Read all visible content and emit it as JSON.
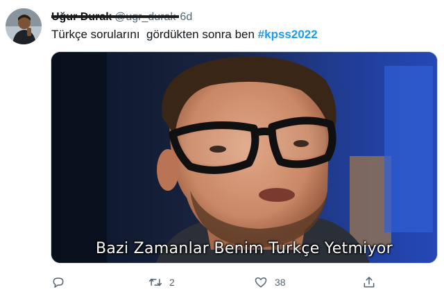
{
  "tweet": {
    "author_name": "Uğur Durak",
    "author_handle": "@ugr_durak",
    "time": "6d",
    "text_plain": "Türkçe sorularını  gördükten sonra ben ",
    "hashtag": "#kpss2022",
    "media": {
      "caption": "Bazi Zamanlar Benim Turkçe Yetmiyor"
    },
    "actions": {
      "reply": {
        "icon": "reply-icon",
        "count": ""
      },
      "retweet": {
        "icon": "retweet-icon",
        "count": "2"
      },
      "like": {
        "icon": "heart-icon",
        "count": "38"
      },
      "share": {
        "icon": "share-icon",
        "count": ""
      }
    }
  },
  "colors": {
    "text": "#0f1419",
    "secondary": "#536471",
    "hashtag": "#1d9bf0"
  }
}
